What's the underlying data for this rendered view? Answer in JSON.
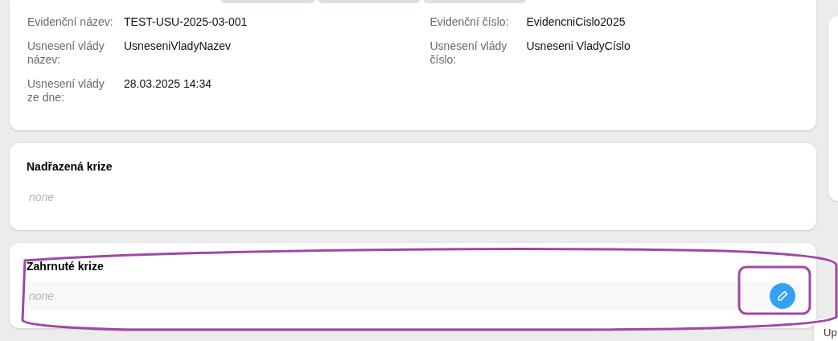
{
  "details": {
    "fields": [
      {
        "label": "Evidenční název:",
        "value": "TEST-USU-2025-03-001"
      },
      {
        "label": "Evidenční číslo:",
        "value": "EvidencniCislo2025"
      },
      {
        "label": "Usnesení vlády název:",
        "value": "UsneseniVladyNazev"
      },
      {
        "label": "Usnesení vlády číslo:",
        "value": "Usneseni VladyCíslo"
      },
      {
        "label": "Usnesení vlády ze dne:",
        "value": "28.03.2025 14:34"
      }
    ]
  },
  "parent_crisis": {
    "title": "Nadřazená krize",
    "empty_text": "none"
  },
  "included_crises": {
    "title": "Zahrnuté krize",
    "empty_text": "none"
  },
  "popup": {
    "text": "Up"
  }
}
